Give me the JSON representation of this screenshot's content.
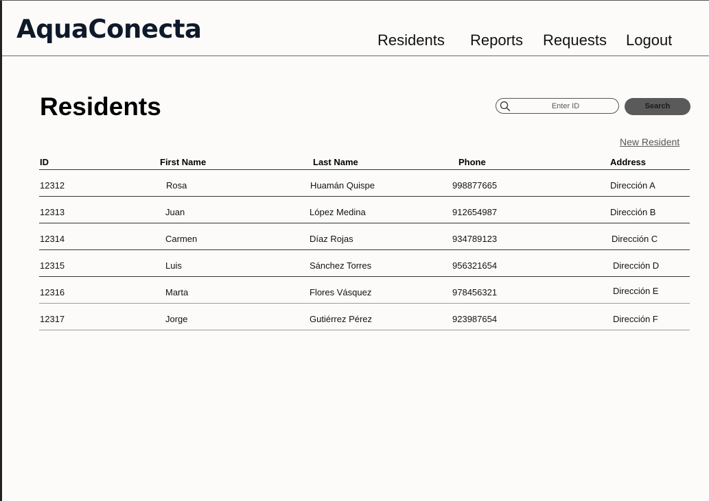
{
  "header": {
    "logo": "AquaConecta",
    "nav": [
      {
        "label": "Residents"
      },
      {
        "label": "Reports"
      },
      {
        "label": "Requests"
      },
      {
        "label": "Logout"
      }
    ]
  },
  "main": {
    "title": "Residents",
    "search": {
      "placeholder": "Enter ID",
      "value": "",
      "button_label": "Search"
    },
    "new_resident_label": "New Resident",
    "table": {
      "columns": [
        "ID",
        "First Name",
        "Last Name",
        "Phone",
        "Address"
      ],
      "rows": [
        {
          "id": "12312",
          "first_name": "Rosa",
          "last_name": "Huamán Quispe",
          "phone": "998877665",
          "address": "Dirección A"
        },
        {
          "id": "12313",
          "first_name": "Juan",
          "last_name": "López Medina",
          "phone": "912654987",
          "address": "Dirección B"
        },
        {
          "id": "12314",
          "first_name": "Carmen",
          "last_name": "Díaz Rojas",
          "phone": "934789123",
          "address": "Dirección C"
        },
        {
          "id": "12315",
          "first_name": "Luis",
          "last_name": "Sánchez Torres",
          "phone": "956321654",
          "address": "Dirección D"
        },
        {
          "id": "12316",
          "first_name": "Marta",
          "last_name": "Flores Vásquez",
          "phone": "978456321",
          "address": "Dirección E"
        },
        {
          "id": "12317",
          "first_name": "Jorge",
          "last_name": "Gutiérrez Pérez",
          "phone": "923987654",
          "address": "Dirección F"
        }
      ]
    }
  },
  "icons": {
    "search": "search-icon"
  },
  "colors": {
    "background": "#fcfbfa",
    "logo": "#0e1a2a",
    "search_button": "#5a5a5a"
  }
}
